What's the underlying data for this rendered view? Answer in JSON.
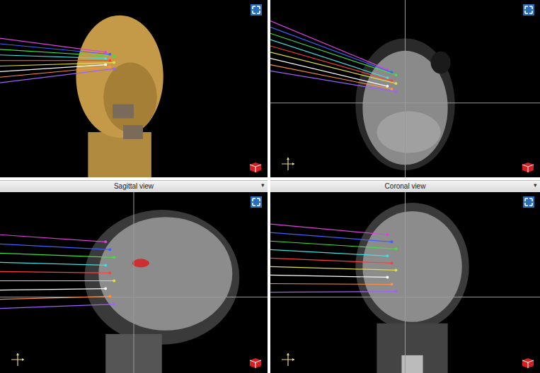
{
  "panels": [
    {
      "kind": "render3d",
      "header": null,
      "menu_glyph": null,
      "crosshair": false,
      "orientation_icon": false
    },
    {
      "kind": "axial",
      "header": null,
      "menu_glyph": null,
      "crosshair": true,
      "orientation_icon": true
    },
    {
      "kind": "sagittal",
      "header": "Sagittal view",
      "menu_glyph": "▾",
      "crosshair": true,
      "orientation_icon": true
    },
    {
      "kind": "coronal",
      "header": "Coronal view",
      "menu_glyph": "▾",
      "crosshair": true,
      "orientation_icon": true
    }
  ],
  "trajectories": [
    {
      "color": "#e040e0"
    },
    {
      "color": "#4060ff"
    },
    {
      "color": "#40e040"
    },
    {
      "color": "#40e0e0"
    },
    {
      "color": "#ff4040"
    },
    {
      "color": "#e0e040"
    },
    {
      "color": "#ffffff"
    },
    {
      "color": "#ff9040"
    },
    {
      "color": "#a060ff"
    }
  ]
}
